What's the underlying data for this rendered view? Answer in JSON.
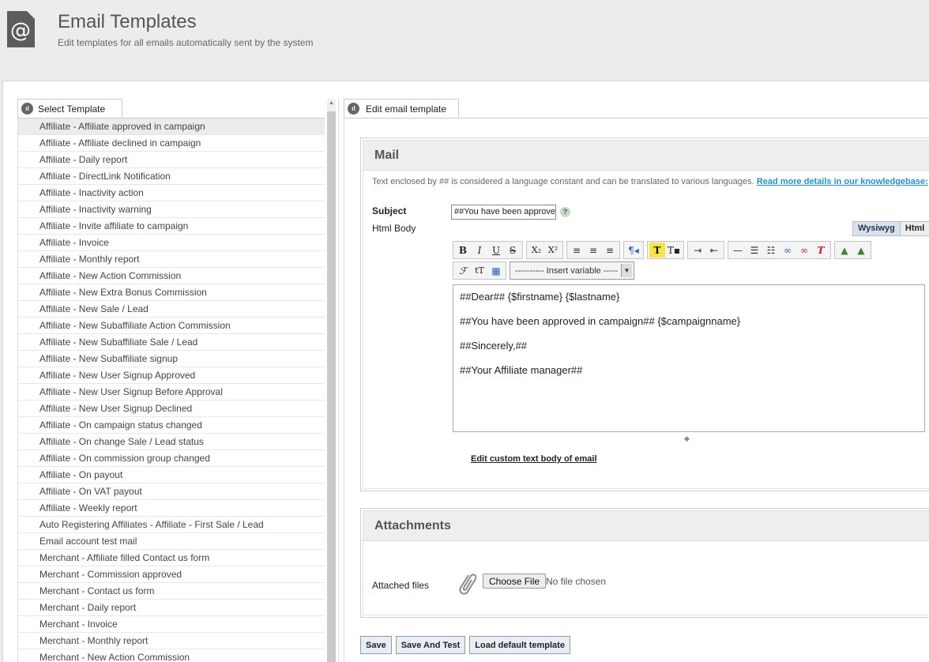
{
  "header": {
    "icon": "at-sign-icon",
    "title": "Email Templates",
    "subtitle": "Edit templates for all emails automatically sent by the system"
  },
  "left": {
    "tab_label": "Select Template",
    "items": [
      "Affiliate - Affiliate approved in campaign",
      "Affiliate - Affiliate declined in campaign",
      "Affiliate - Daily report",
      "Affiliate - DirectLink Notification",
      "Affiliate - Inactivity action",
      "Affiliate - Inactivity warning",
      "Affiliate - Invite affiliate to campaign",
      "Affiliate - Invoice",
      "Affiliate - Monthly report",
      "Affiliate - New Action Commission",
      "Affiliate - New Extra Bonus Commission",
      "Affiliate - New Sale / Lead",
      "Affiliate - New Subaffiliate Action Commission",
      "Affiliate - New Subaffiliate Sale / Lead",
      "Affiliate - New Subaffiliate signup",
      "Affiliate - New User Signup Approved",
      "Affiliate - New User Signup Before Approval",
      "Affiliate - New User Signup Declined",
      "Affiliate - On campaign status changed",
      "Affiliate - On change Sale / Lead status",
      "Affiliate - On commission group changed",
      "Affiliate - On payout",
      "Affiliate - On VAT payout",
      "Affiliate - Weekly report",
      "Auto Registering Affiliates - Affiliate - First Sale / Lead",
      "Email account test mail",
      "Merchant - Affiliate filled Contact us form",
      "Merchant - Commission approved",
      "Merchant - Contact us form",
      "Merchant - Daily report",
      "Merchant - Invoice",
      "Merchant - Monthly report",
      "Merchant - New Action Commission"
    ]
  },
  "right": {
    "tab_label": "Edit email template",
    "mail": {
      "heading": "Mail",
      "notice": "Text enclosed by ## is considered a language constant and can be translated to various languages.",
      "notice_link": "Read more details in our knowledgebase:",
      "subject_label": "Subject",
      "subject_value": "##You have been approve",
      "help": "?",
      "html_body_label": "Html Body",
      "mode_wysiwyg": "Wysiwyg",
      "mode_html": "Html",
      "insert_variable": "---------- Insert variable -----",
      "body_lines": [
        "##Dear## {$firstname} {$lastname}",
        "##You have been approved in campaign## {$campaignname}",
        "##Sincerely,##",
        "##Your Affiliate manager##"
      ],
      "custom_link": "Edit custom text body of email"
    },
    "attachments": {
      "heading": "Attachments",
      "label": "Attached files",
      "choose_button": "Choose File",
      "no_file": "No file chosen"
    },
    "buttons": {
      "save": "Save",
      "save_test": "Save And Test",
      "load_default": "Load default template"
    }
  },
  "toolbar": {
    "bold": "B",
    "italic": "I",
    "underline": "U",
    "strike": "S",
    "sub": "X₂",
    "sup": "X²"
  }
}
